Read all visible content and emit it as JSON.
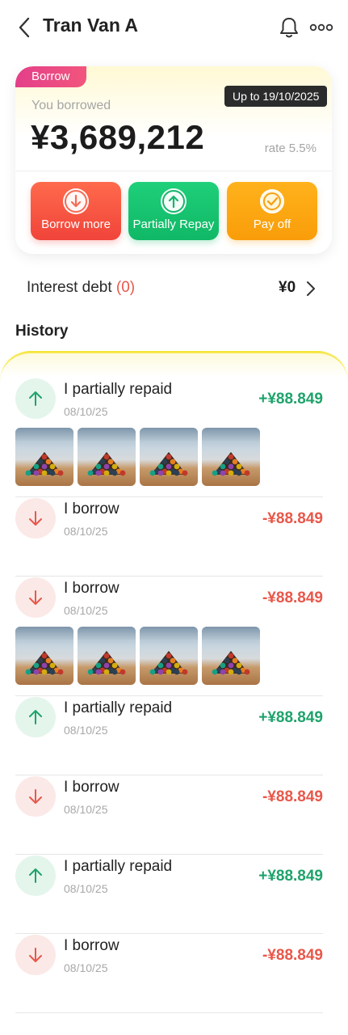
{
  "header": {
    "title": "Tran Van A",
    "back_icon": "chevron-left-icon",
    "bell_icon": "bell-icon",
    "more_icon": "more-dots-icon"
  },
  "loan_card": {
    "tag": "Borrow",
    "label": "You borrowed",
    "amount": "¥3,689,212",
    "due": "Up to 19/10/2025",
    "rate": "rate 5.5%",
    "actions": [
      {
        "label": "Borrow more",
        "icon": "arrow-down-circle-icon",
        "color": "#f0443a"
      },
      {
        "label": "Partially Repay",
        "icon": "arrow-up-circle-icon",
        "color": "#10b866"
      },
      {
        "label": "Pay off",
        "icon": "check-circle-icon",
        "color": "#f99d09"
      }
    ]
  },
  "interest": {
    "label": "Interest debt",
    "count": "(0)",
    "value": "¥0"
  },
  "history": {
    "title": "History",
    "items": [
      {
        "type": "repay",
        "name": "I partially repaid",
        "date": "08/10/25",
        "amount": "+¥88.849",
        "photos": 4
      },
      {
        "type": "borrow",
        "name": "I borrow",
        "date": "08/10/25",
        "amount": "-¥88.849",
        "photos": 0
      },
      {
        "type": "borrow",
        "name": "I borrow",
        "date": "08/10/25",
        "amount": "-¥88.849",
        "photos": 4
      },
      {
        "type": "repay",
        "name": "I partially repaid",
        "date": "08/10/25",
        "amount": "+¥88.849",
        "photos": 0
      },
      {
        "type": "borrow",
        "name": "I borrow",
        "date": "08/10/25",
        "amount": "-¥88.849",
        "photos": 0
      },
      {
        "type": "repay",
        "name": "I partially repaid",
        "date": "08/10/25",
        "amount": "+¥88.849",
        "photos": 0
      },
      {
        "type": "borrow",
        "name": "I borrow",
        "date": "08/10/25",
        "amount": "-¥88.849",
        "photos": 0
      }
    ]
  },
  "colors": {
    "plus": "#1ea36b",
    "minus": "#e8574a",
    "accent_yellow": "#f5e53a"
  }
}
